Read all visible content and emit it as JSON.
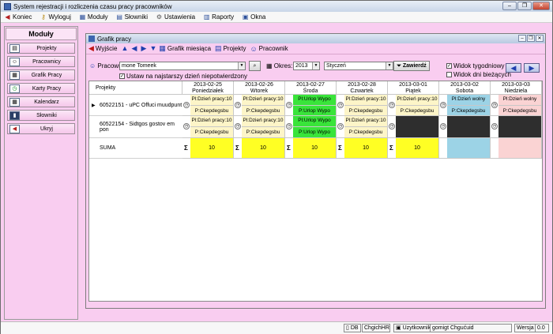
{
  "window": {
    "title": "System rejestracji i rozliczenia czasu pracy pracowników"
  },
  "menu": [
    {
      "label": "Koniec",
      "icon": "exit-icon"
    },
    {
      "label": "Wyloguj",
      "icon": "key-icon"
    },
    {
      "label": "Moduły",
      "icon": "modules-icon"
    },
    {
      "label": "Słowniki",
      "icon": "dictionary-icon"
    },
    {
      "label": "Ustawienia",
      "icon": "settings-icon"
    },
    {
      "label": "Raporty",
      "icon": "reports-icon"
    },
    {
      "label": "Okna",
      "icon": "windows-icon"
    }
  ],
  "left_panel": {
    "title": "Moduły",
    "items": [
      "Projekty",
      "Pracownicy",
      "Grafik Pracy",
      "Karty Pracy",
      "Kalendarz",
      "Słowniki",
      "Ukryj"
    ]
  },
  "child_window": {
    "title": "Grafik pracy"
  },
  "toolbar": {
    "exit": "Wyjście",
    "month_schedule": "Grafik miesiąca",
    "projects": "Projekty",
    "employee": "Pracownik"
  },
  "filter": {
    "employee_label": "Pracownik:",
    "employee_value": "mone Tomeek",
    "set_unfinished": "Ustaw na najstarszy dzień niepotwierdzony",
    "period_label": "Okres:",
    "year": "2013",
    "month": "Styczeń",
    "apply": "Zawierdź",
    "weekly_view": "Widok tygodniowy",
    "current_days_view": "Widok dni bieżących"
  },
  "grid": {
    "project_header": "Projekty",
    "days": [
      {
        "date": "2013-02-25",
        "name": "Poniedziałek"
      },
      {
        "date": "2013-02-26",
        "name": "Wtorek"
      },
      {
        "date": "2013-02-27",
        "name": "Środa"
      },
      {
        "date": "2013-02-28",
        "name": "Czwartek"
      },
      {
        "date": "2013-03-01",
        "name": "Piątek"
      },
      {
        "date": "2013-03-02",
        "name": "Sobota"
      },
      {
        "date": "2013-03-03",
        "name": "Niedziela"
      }
    ],
    "rows": [
      {
        "project": "60522151 - uPC Offuci muudpunt",
        "cells": [
          {
            "l1": "Pl:Dzień pracy:10",
            "l2": "P:Ckepdegsbu"
          },
          {
            "l1": "Pl:Dzień pracy:10",
            "l2": "P:Ckepdegsbu"
          },
          {
            "l1": "Pl:Urlop Wypo",
            "l2": "P:Urlop Wypo"
          },
          {
            "l1": "Pl:Dzień pracy:10",
            "l2": "P:Ckepdegsbu"
          },
          {
            "l1": "Pl:Dzień pracy:10",
            "l2": "P:Ckepdegsbu"
          },
          {
            "l1": "Pl:Dzień wolny",
            "l2": "P:Ckepdegsbu"
          },
          {
            "l1": "Pl:Dzień wolny",
            "l2": "P:Ckepdegsbu"
          }
        ]
      },
      {
        "project": "60522154 - Sidtgos gostov em pon",
        "cells": [
          {
            "l1": "Pl:Dzień pracy:10",
            "l2": "P:Ckepdegsbu"
          },
          {
            "l1": "Pl:Dzień pracy:10",
            "l2": "P:Ckepdegsbu"
          },
          {
            "l1": "Pl:Urlop Wypo",
            "l2": "P:Urlop Wypo"
          },
          {
            "l1": "Pl:Dzień pracy:10",
            "l2": "P:Ckepdegsbu"
          },
          {
            "l1": "",
            "l2": ""
          },
          {
            "l1": "",
            "l2": ""
          },
          {
            "l1": "",
            "l2": ""
          }
        ]
      }
    ],
    "sum_label": "SUMA",
    "sums": [
      "10",
      "10",
      "10",
      "10",
      "10",
      "",
      ""
    ]
  },
  "colors": {
    "workday": "#fdf5c8",
    "vacation": "#39e43a",
    "saturday": "#9cd3e6",
    "sunday": "#fad3d3",
    "empty": "#2e2e2e",
    "sum": "#ffff24"
  },
  "status": {
    "db_label": "DB",
    "db_value": "ChgichHR",
    "user_label": "Uzytkownik",
    "user_value": "gomigt Chgućuid",
    "version_label": "Wersja",
    "version_value": "0.0"
  }
}
